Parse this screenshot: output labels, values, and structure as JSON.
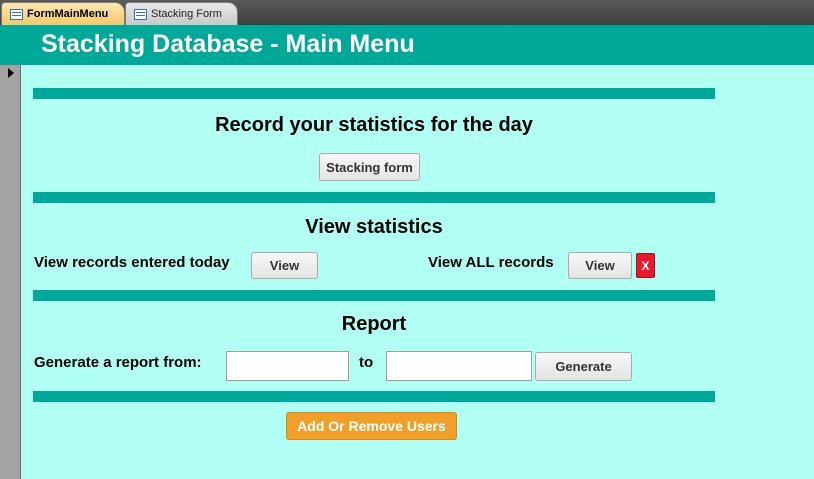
{
  "tabs": [
    {
      "label": "FormMainMenu",
      "icon": "form-icon",
      "active": true
    },
    {
      "label": "Stacking Form",
      "icon": "form-icon",
      "active": false
    }
  ],
  "header": {
    "title": "Stacking Database - Main Menu"
  },
  "record_section": {
    "title": "Record your statistics for the day",
    "button_label": "Stacking form"
  },
  "view_section": {
    "title": "View statistics",
    "today_label": "View records entered today",
    "today_button": "View",
    "all_label": "View ALL records",
    "all_button": "View",
    "close_button": "X"
  },
  "report_section": {
    "title": "Report",
    "from_label": "Generate a report from:",
    "from_value": "",
    "to_label": "to",
    "to_value": "",
    "generate_button": "Generate"
  },
  "users_button": "Add Or Remove Users",
  "colors": {
    "background": "#b2fff4",
    "accent": "#00a89a",
    "orange": "#f0a028",
    "danger": "#e8192c"
  }
}
